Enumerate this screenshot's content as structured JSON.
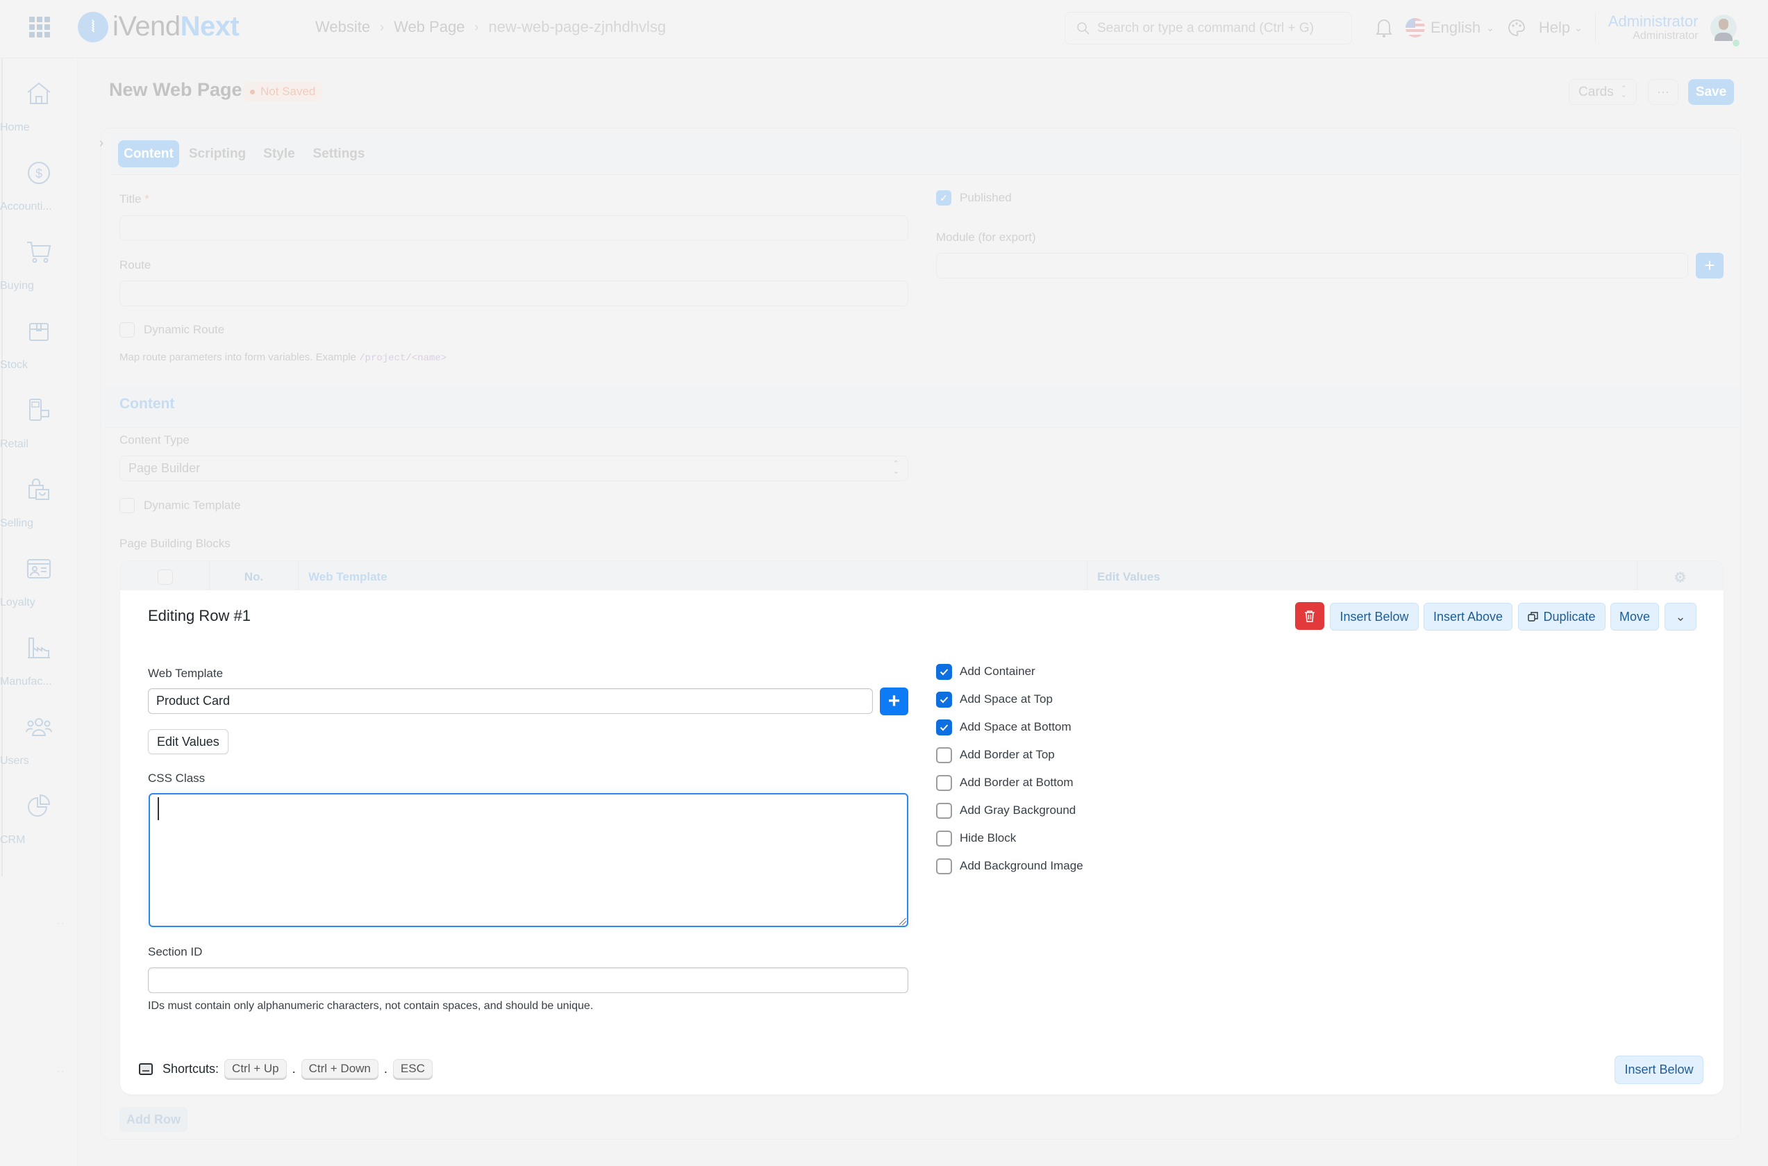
{
  "navbar": {
    "logo_prefix": "iVend",
    "logo_suffix": "Next",
    "breadcrumb": [
      "Website",
      "Web Page",
      "new-web-page-zjnhdhvlsg"
    ],
    "search_placeholder": "Search or type a command (Ctrl + G)",
    "language": "English",
    "help": "Help",
    "user_name": "Administrator",
    "user_role": "Administrator",
    "icons": {
      "apps": "apps-grid-icon",
      "search": "search-icon",
      "notifications": "bell-icon",
      "theme": "palette-icon"
    }
  },
  "sidebar": {
    "items": [
      {
        "label": "Home",
        "icon": "home-icon"
      },
      {
        "label": "Accounti...",
        "icon": "dollar-icon"
      },
      {
        "label": "Buying",
        "icon": "cart-icon"
      },
      {
        "label": "Stock",
        "icon": "box-icon"
      },
      {
        "label": "Retail",
        "icon": "pos-terminal-icon"
      },
      {
        "label": "Selling",
        "icon": "shopping-bag-icon"
      },
      {
        "label": "Loyalty",
        "icon": "id-card-icon"
      },
      {
        "label": "Manufac...",
        "icon": "factory-icon"
      },
      {
        "label": "Users",
        "icon": "users-icon"
      },
      {
        "label": "CRM",
        "icon": "pie-chart-icon"
      }
    ]
  },
  "page": {
    "title": "New Web Page",
    "status": "Not Saved",
    "view_select": "Cards",
    "more_label": "···",
    "save_label": "Save"
  },
  "tabs": [
    {
      "label": "Content",
      "active": true
    },
    {
      "label": "Scripting",
      "active": false
    },
    {
      "label": "Style",
      "active": false
    },
    {
      "label": "Settings",
      "active": false
    }
  ],
  "form": {
    "title_label": "Title",
    "title_required": "*",
    "title_value": "",
    "route_label": "Route",
    "route_value": "",
    "dynamic_route_label": "Dynamic Route",
    "dynamic_route_checked": false,
    "route_help": "Map route parameters into form variables. Example",
    "route_help_code": "/project/<name>",
    "published_label": "Published",
    "published_checked": true,
    "module_label": "Module (for export)",
    "module_value": "",
    "content_section": "Content",
    "content_type_label": "Content Type",
    "content_type_value": "Page Builder",
    "dynamic_template_label": "Dynamic Template",
    "dynamic_template_checked": false,
    "blocks_label": "Page Building Blocks",
    "grid_columns": [
      "No.",
      "Web Template",
      "Edit Values"
    ],
    "add_row_label": "Add Row"
  },
  "editing_row": {
    "title": "Editing Row #1",
    "actions": [
      "Insert Below",
      "Insert Above",
      "Duplicate",
      "Move"
    ],
    "web_template_label": "Web Template",
    "web_template_value": "Product Card",
    "edit_values_label": "Edit Values",
    "css_class_label": "CSS Class",
    "css_class_value": "",
    "section_id_label": "Section ID",
    "section_id_value": "",
    "section_id_help": "IDs must contain only alphanumeric characters, not contain spaces, and should be unique.",
    "options": [
      {
        "label": "Add Container",
        "checked": true
      },
      {
        "label": "Add Space at Top",
        "checked": true
      },
      {
        "label": "Add Space at Bottom",
        "checked": true
      },
      {
        "label": "Add Border at Top",
        "checked": false
      },
      {
        "label": "Add Border at Bottom",
        "checked": false
      },
      {
        "label": "Add Gray Background",
        "checked": false
      },
      {
        "label": "Hide Block",
        "checked": false
      },
      {
        "label": "Add Background Image",
        "checked": false
      }
    ],
    "shortcuts_label": "Shortcuts:",
    "shortcuts": [
      "Ctrl + Up",
      "Ctrl + Down",
      "ESC"
    ],
    "shortcut_separator": ".",
    "insert_below_bottom": "Insert Below"
  },
  "colors": {
    "primary": "#0d7bf5",
    "danger": "#e2393a",
    "action_bg": "#e3f0fd",
    "action_text": "#1f5d95"
  }
}
